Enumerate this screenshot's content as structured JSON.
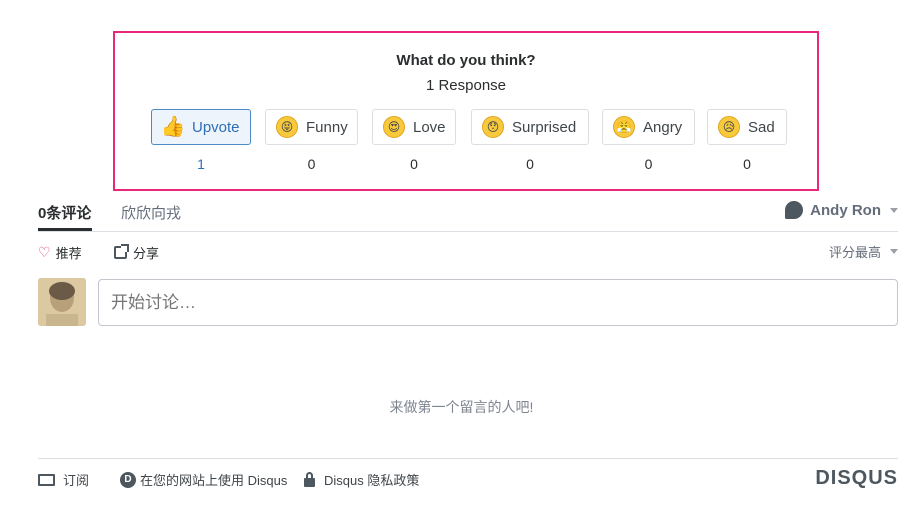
{
  "reactions": {
    "title": "What do you think?",
    "count_text": "1 Response",
    "items": [
      {
        "label": "Upvote",
        "count": "1",
        "icon": "thumbs-up-icon",
        "glyph": "👍",
        "active": true
      },
      {
        "label": "Funny",
        "count": "0",
        "icon": "funny-face-icon",
        "glyph": "😝",
        "active": false
      },
      {
        "label": "Love",
        "count": "0",
        "icon": "heart-eyes-icon",
        "glyph": "😍",
        "active": false
      },
      {
        "label": "Surprised",
        "count": "0",
        "icon": "surprised-face-icon",
        "glyph": "😯",
        "active": false
      },
      {
        "label": "Angry",
        "count": "0",
        "icon": "angry-face-icon",
        "glyph": "😤",
        "active": false
      },
      {
        "label": "Sad",
        "count": "0",
        "icon": "sad-face-icon",
        "glyph": "😥",
        "active": false
      }
    ],
    "highlight_color": "#e8277a"
  },
  "tabs": {
    "comments_tab": "0条评论",
    "community_tab": "欣欣向戎",
    "user_name": "Andy Ron"
  },
  "actions": {
    "recommend": "推荐",
    "share": "分享",
    "sort": "评分最高"
  },
  "composer": {
    "placeholder": "开始讨论…"
  },
  "empty_message": "来做第一个留言的人吧!",
  "footer": {
    "subscribe": "订阅",
    "add_disqus": "在您的网站上使用 Disqus",
    "privacy": "Disqus 隐私政策",
    "logo": "DISQUS"
  }
}
